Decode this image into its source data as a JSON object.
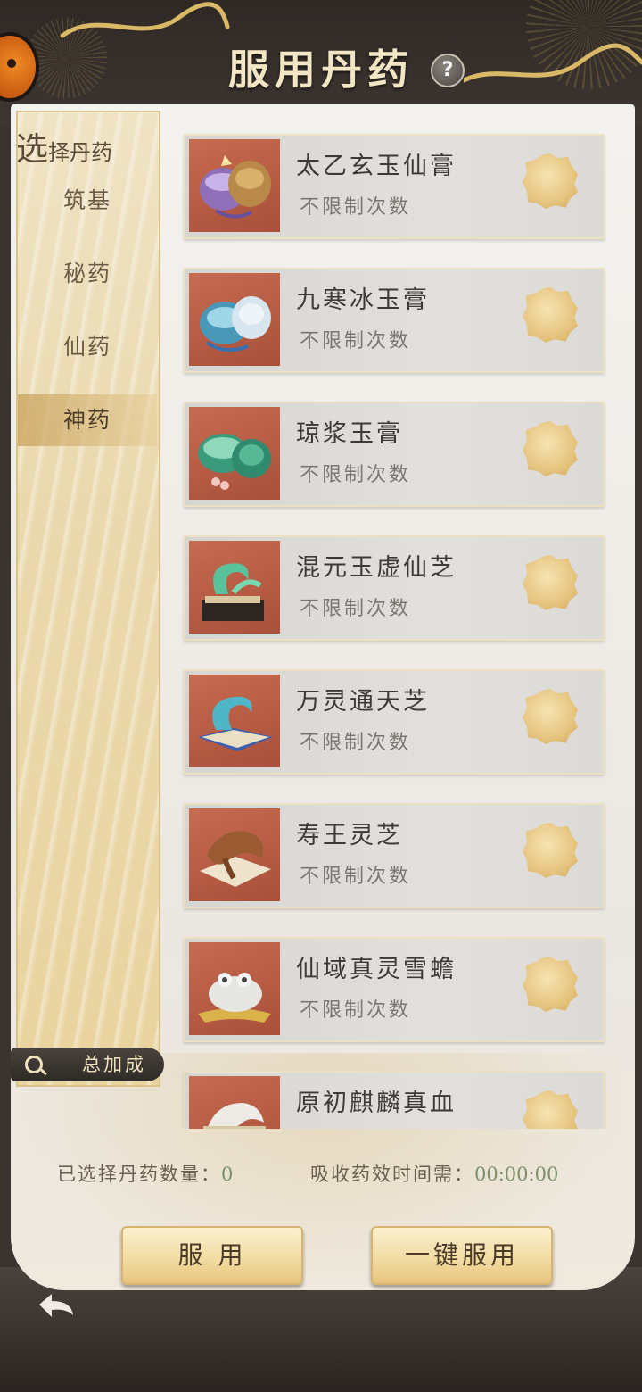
{
  "header": {
    "title": "服用丹药",
    "help_glyph": "?"
  },
  "sidebar": {
    "heading_first": "选",
    "heading_rest": "择丹药",
    "items": [
      {
        "label": "筑基",
        "active": false
      },
      {
        "label": "秘药",
        "active": false
      },
      {
        "label": "仙药",
        "active": false
      },
      {
        "label": "神药",
        "active": true
      }
    ],
    "bonus_label": "总加成"
  },
  "medicines": [
    {
      "name": "太乙玄玉仙膏",
      "limit": "不限制次数",
      "icon": "jar-with-lid-icon"
    },
    {
      "name": "九寒冰玉膏",
      "limit": "不限制次数",
      "icon": "blue-jar-icon"
    },
    {
      "name": "琼浆玉膏",
      "limit": "不限制次数",
      "icon": "green-jar-icon"
    },
    {
      "name": "混元玉虚仙芝",
      "limit": "不限制次数",
      "icon": "jade-fungus-icon"
    },
    {
      "name": "万灵通天芝",
      "limit": "不限制次数",
      "icon": "blue-fungus-icon"
    },
    {
      "name": "寿王灵芝",
      "limit": "不限制次数",
      "icon": "lingzhi-icon"
    },
    {
      "name": "仙域真灵雪蟾",
      "limit": "不限制次数",
      "icon": "snow-toad-icon"
    },
    {
      "name": "原初麒麟真血",
      "limit": "",
      "icon": "qilin-icon"
    }
  ],
  "footer": {
    "selected_label": "已选择丹药数量：",
    "selected_value": "0",
    "time_label": "吸收药效时间需：",
    "time_value": "00:00:00"
  },
  "buttons": {
    "take": "服 用",
    "take_all": "一键服用"
  }
}
